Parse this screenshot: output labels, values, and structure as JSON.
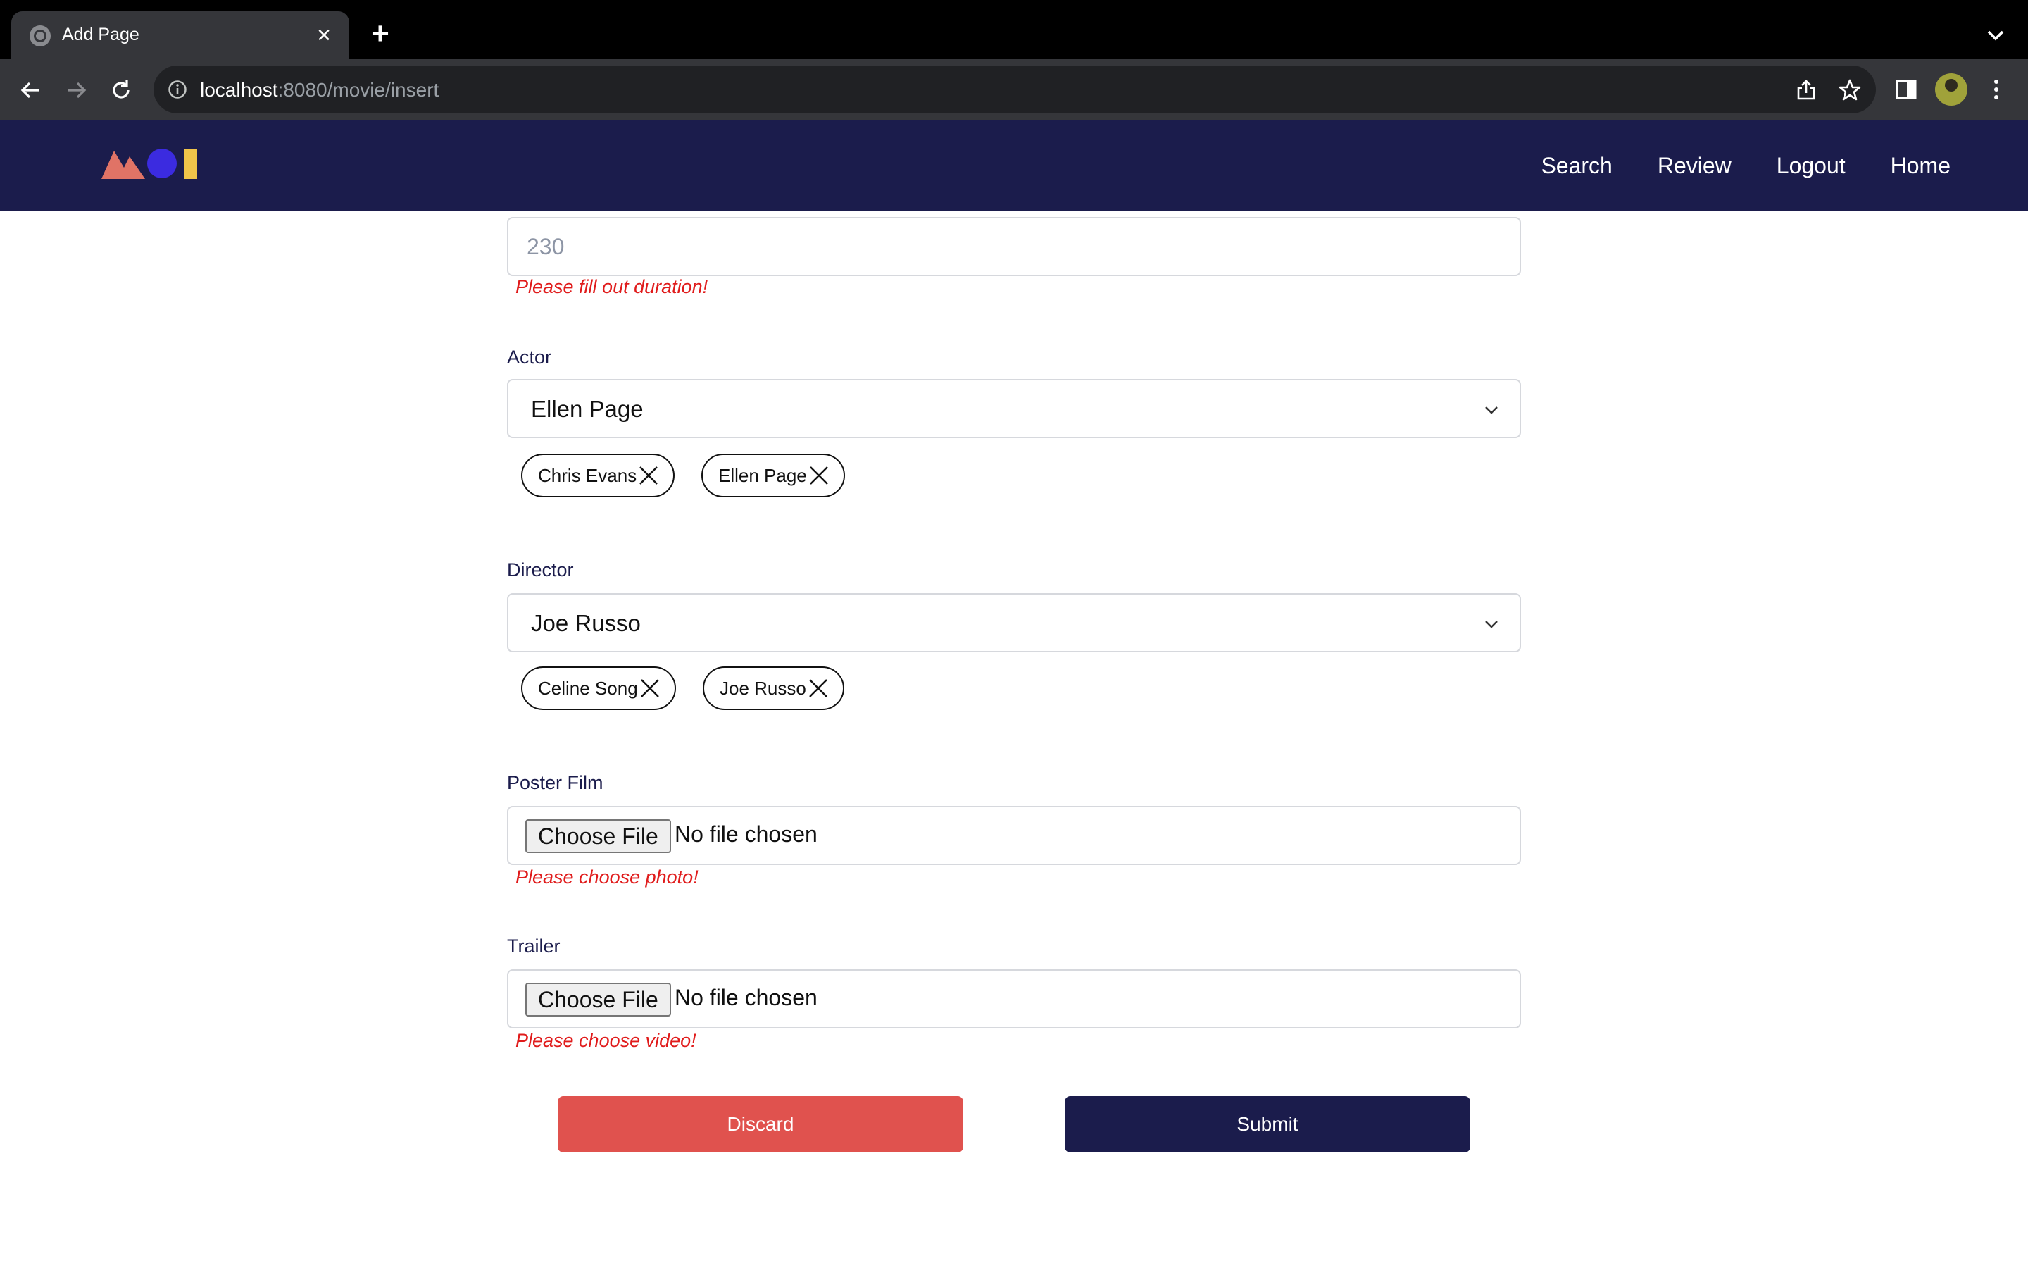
{
  "browser": {
    "tab_title": "Add Page",
    "tab_close": "×",
    "new_tab": "+",
    "url_host": "localhost",
    "url_rest": ":8080/movie/insert"
  },
  "app": {
    "nav": {
      "search": "Search",
      "review": "Review",
      "logout": "Logout",
      "home": "Home"
    },
    "colors": {
      "header_bg": "#1b1c4c",
      "discard": "#e0524e",
      "submit": "#1b1c4c",
      "error": "#e01b1b",
      "logo_triangle": "#e07366",
      "logo_circle": "#3b2be0",
      "logo_bar": "#f0c44a"
    }
  },
  "form": {
    "duration": {
      "placeholder": "230",
      "error": "Please fill out duration!"
    },
    "actor": {
      "label": "Actor",
      "selected": "Ellen Page",
      "chips": [
        "Chris Evans",
        "Ellen Page"
      ]
    },
    "director": {
      "label": "Director",
      "selected": "Joe Russo",
      "chips": [
        "Celine Song",
        "Joe Russo"
      ]
    },
    "poster": {
      "label": "Poster Film",
      "button": "Choose File",
      "status": "No file chosen",
      "error": "Please choose photo!"
    },
    "trailer": {
      "label": "Trailer",
      "button": "Choose File",
      "status": "No file chosen",
      "error": "Please choose video!"
    },
    "discard": "Discard",
    "submit": "Submit"
  }
}
